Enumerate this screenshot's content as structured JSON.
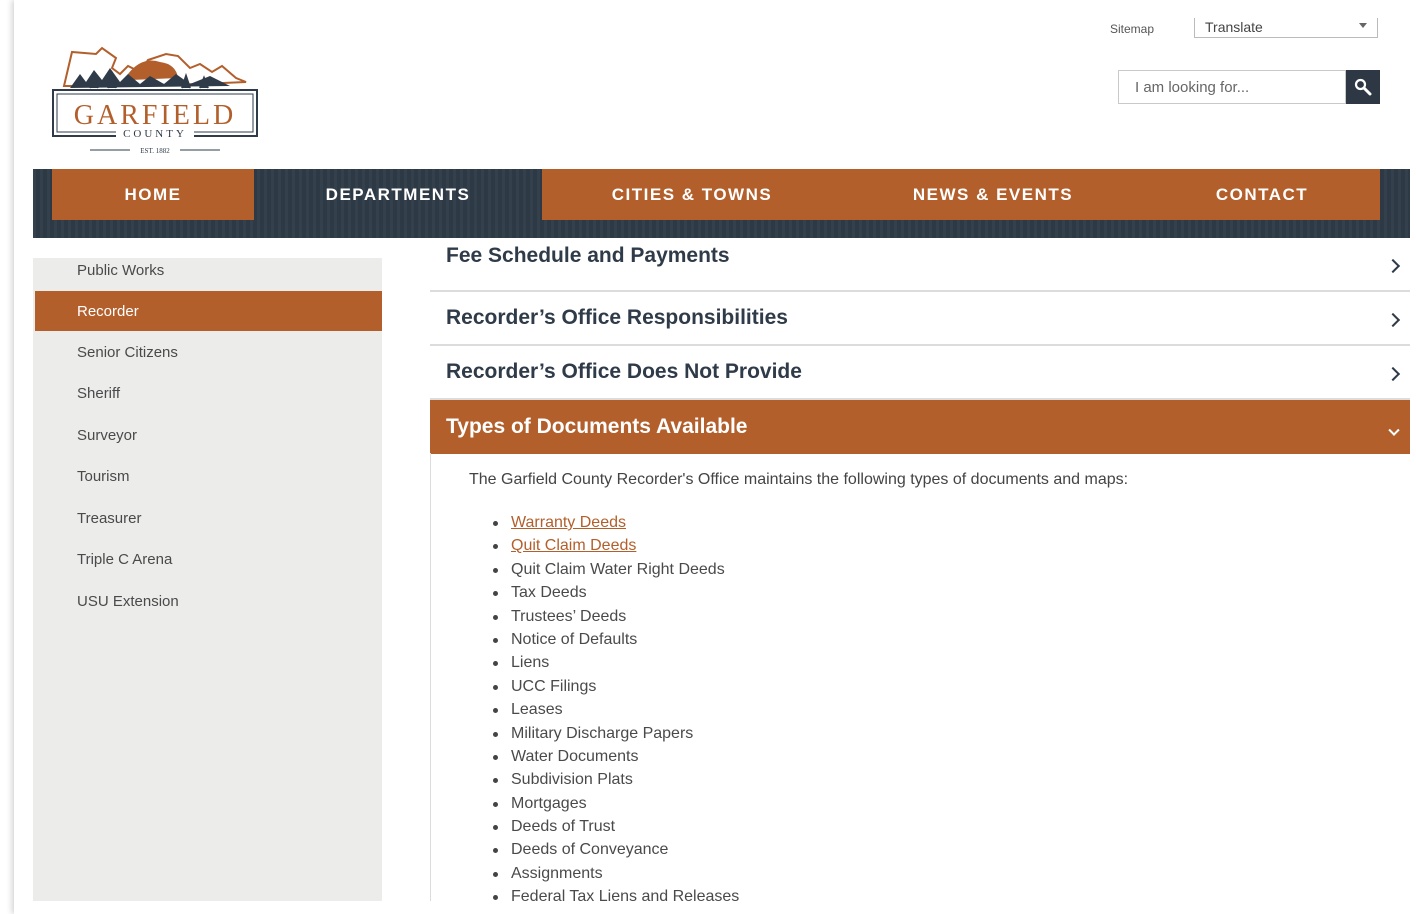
{
  "header": {
    "logo": {
      "name": "GARFIELD",
      "county": "COUNTY",
      "established": "EST. 1882"
    },
    "sitemap_label": "Sitemap",
    "translate_label": "Translate",
    "search_placeholder": "I am looking for..."
  },
  "nav": {
    "items": [
      {
        "label": "HOME"
      },
      {
        "label": "DEPARTMENTS"
      },
      {
        "label": "CITIES & TOWNS"
      },
      {
        "label": "NEWS & EVENTS"
      },
      {
        "label": "CONTACT"
      }
    ]
  },
  "sidebar": {
    "items": [
      {
        "label": "Public Works"
      },
      {
        "label": "Recorder",
        "active": true
      },
      {
        "label": "Senior Citizens"
      },
      {
        "label": "Sheriff"
      },
      {
        "label": "Surveyor"
      },
      {
        "label": "Tourism"
      },
      {
        "label": "Treasurer"
      },
      {
        "label": "Triple C Arena"
      },
      {
        "label": "USU Extension"
      }
    ]
  },
  "accordion": {
    "sections": [
      {
        "title": "Fee Schedule and Payments"
      },
      {
        "title": "Recorder’s Office Responsibilities"
      },
      {
        "title": "Recorder’s Office Does Not Provide"
      },
      {
        "title": "Types of Documents Available",
        "open": true
      }
    ],
    "open_section": {
      "intro": "The Garfield County Recorder's Office maintains the following types of documents and maps:",
      "documents": [
        {
          "label": "Warranty Deeds",
          "link": true
        },
        {
          "label": "Quit Claim Deeds",
          "link": true
        },
        {
          "label": "Quit Claim Water Right Deeds"
        },
        {
          "label": "Tax Deeds"
        },
        {
          "label": "Trustees’ Deeds"
        },
        {
          "label": "Notice of Defaults"
        },
        {
          "label": "Liens"
        },
        {
          "label": "UCC Filings"
        },
        {
          "label": "Leases"
        },
        {
          "label": "Military Discharge Papers"
        },
        {
          "label": "Water Documents"
        },
        {
          "label": "Subdivision Plats"
        },
        {
          "label": "Mortgages"
        },
        {
          "label": "Deeds of Trust"
        },
        {
          "label": "Deeds of Conveyance"
        },
        {
          "label": "Assignments"
        },
        {
          "label": "Federal Tax Liens and Releases"
        }
      ]
    }
  },
  "colors": {
    "accent": "#b35f2c",
    "navy": "#2f3b48",
    "sidebar_bg": "#ececeb"
  }
}
